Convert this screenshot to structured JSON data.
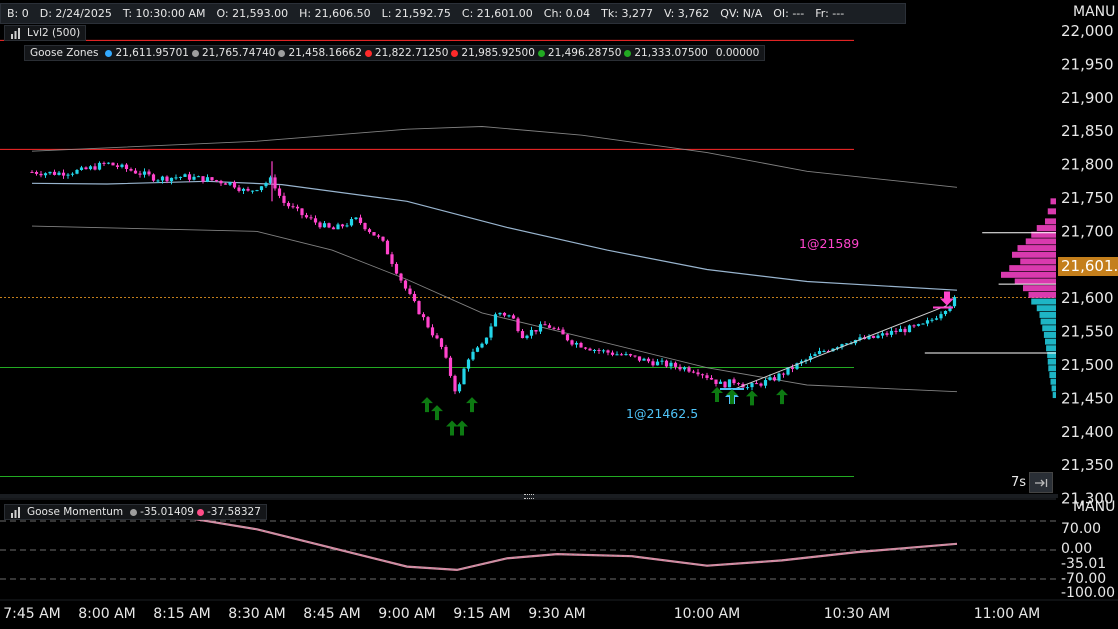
{
  "header": {
    "items": [
      "B: 0",
      "D: 2/24/2025",
      "T: 10:30:00 AM",
      "O: 21,593.00",
      "H: 21,606.50",
      "L: 21,592.75",
      "C: 21,601.00",
      "Ch: 0.04",
      "Tk: 3,277",
      "V: 3,762",
      "QV: N/A",
      "OI: ---",
      "Fr: ---"
    ]
  },
  "price_panel": {
    "scale_label": "MANU",
    "current_price": "21,601.0",
    "current_price_value": 21601,
    "bar_timeframe": "7s",
    "lvl2_label": "Lvl2 (500)",
    "zones_label": "Goose Zones",
    "zones": [
      {
        "value": "21,611.95701",
        "color": "#33aaff"
      },
      {
        "value": "21,765.74740",
        "color": "#9e9e9e"
      },
      {
        "value": "21,458.16662",
        "color": "#9e9e9e"
      },
      {
        "value": "21,822.71250",
        "color": "#ff2a2a"
      },
      {
        "value": "21,985.92500",
        "color": "#ff2a2a"
      },
      {
        "value": "21,496.28750",
        "color": "#22aa22"
      },
      {
        "value": "21,333.07500",
        "color": "#22aa22"
      },
      {
        "value": "0.00000",
        "color": null
      }
    ],
    "sell_annotation": "1@21589",
    "buy_annotation": "1@21462.5"
  },
  "momentum_panel": {
    "label": "Goose Momentum",
    "values": [
      {
        "value": "-35.01409",
        "color": "#9e9e9e"
      },
      {
        "value": "-37.58327",
        "color": "#ff4d88"
      }
    ],
    "scale_label": "MANU",
    "levels": [
      "70.00",
      "0.00",
      "-35.01",
      "-70.00",
      "-100.00"
    ]
  },
  "colors": {
    "up_candle": "#23d5e8",
    "down_candle": "#ff44cc",
    "accent": "#ff44cc",
    "buy": "#4fc3f7",
    "signal_arrow": "#0d7a12"
  },
  "chart_data": {
    "type": "candlestick",
    "x_ticks": [
      "7:45 AM",
      "8:00 AM",
      "8:15 AM",
      "8:30 AM",
      "8:45 AM",
      "9:00 AM",
      "9:15 AM",
      "9:30 AM",
      "10:00 AM",
      "10:30 AM",
      "11:00 AM"
    ],
    "y_ticks": [
      22000,
      21950,
      21900,
      21850,
      21800,
      21750,
      21700,
      21650,
      21600,
      21550,
      21500,
      21450,
      21400,
      21350,
      21300
    ],
    "ylim": [
      21300,
      22015
    ],
    "close_path": [
      [
        "7:45",
        21789
      ],
      [
        "7:50",
        21787
      ],
      [
        "7:55",
        21791
      ],
      [
        "8:00",
        21802
      ],
      [
        "8:05",
        21791
      ],
      [
        "8:10",
        21779
      ],
      [
        "8:15",
        21782
      ],
      [
        "8:20",
        21778
      ],
      [
        "8:25",
        21772
      ],
      [
        "8:28",
        21758
      ],
      [
        "8:33",
        21778
      ],
      [
        "8:35",
        21745
      ],
      [
        "8:40",
        21720
      ],
      [
        "8:45",
        21702
      ],
      [
        "8:50",
        21718
      ],
      [
        "8:55",
        21685
      ],
      [
        "9:00",
        21610
      ],
      [
        "9:02",
        21585
      ],
      [
        "9:07",
        21525
      ],
      [
        "9:10",
        21455
      ],
      [
        "9:12",
        21510
      ],
      [
        "9:15",
        21528
      ],
      [
        "9:18",
        21580
      ],
      [
        "9:21",
        21572
      ],
      [
        "9:23",
        21545
      ],
      [
        "9:28",
        21560
      ],
      [
        "9:33",
        21535
      ],
      [
        "9:38",
        21522
      ],
      [
        "9:43",
        21515
      ],
      [
        "9:48",
        21506
      ],
      [
        "9:53",
        21499
      ],
      [
        "9:58",
        21492
      ],
      [
        "10:03",
        21470
      ],
      [
        "10:06",
        21477
      ],
      [
        "10:08",
        21466
      ],
      [
        "10:13",
        21478
      ],
      [
        "10:18",
        21500
      ],
      [
        "10:23",
        21520
      ],
      [
        "10:28",
        21536
      ],
      [
        "10:33",
        21540
      ],
      [
        "10:38",
        21551
      ],
      [
        "10:43",
        21558
      ],
      [
        "10:45",
        21568
      ],
      [
        "10:50",
        21601
      ]
    ],
    "horizontal_lines": [
      {
        "name": "zone-red-upper",
        "value": 21985.925,
        "color": "#ff2a2a"
      },
      {
        "name": "zone-red-lower",
        "value": 21822.7125,
        "color": "#ff2a2a"
      },
      {
        "name": "zone-green-upper",
        "value": 21496.2875,
        "color": "#22aa22"
      },
      {
        "name": "zone-green-lower",
        "value": 21333.075,
        "color": "#22aa22"
      }
    ],
    "bands": [
      {
        "name": "upper-band",
        "color": "#8f8f8f",
        "path": [
          [
            "7:45",
            21820
          ],
          [
            "8:30",
            21835
          ],
          [
            "9:00",
            21853
          ],
          [
            "9:15",
            21857
          ],
          [
            "9:35",
            21844
          ],
          [
            "10:00",
            21818
          ],
          [
            "10:20",
            21790
          ],
          [
            "10:50",
            21766
          ]
        ]
      },
      {
        "name": "middle-band",
        "color": "#a9c8e4",
        "path": [
          [
            "7:45",
            21772
          ],
          [
            "8:00",
            21771
          ],
          [
            "8:20",
            21775
          ],
          [
            "8:35",
            21770
          ],
          [
            "9:00",
            21745
          ],
          [
            "9:20",
            21706
          ],
          [
            "9:40",
            21672
          ],
          [
            "10:00",
            21643
          ],
          [
            "10:20",
            21625
          ],
          [
            "10:50",
            21612
          ]
        ]
      },
      {
        "name": "lower-band",
        "color": "#8f8f8f",
        "path": [
          [
            "7:45",
            21708
          ],
          [
            "8:30",
            21700
          ],
          [
            "8:45",
            21672
          ],
          [
            "9:00",
            21628
          ],
          [
            "9:15",
            21578
          ],
          [
            "9:35",
            21542
          ],
          [
            "10:00",
            21496
          ],
          [
            "10:20",
            21470
          ],
          [
            "10:50",
            21460
          ]
        ]
      }
    ],
    "volume_profile": [
      {
        "price": 21745,
        "volume": 0.1
      },
      {
        "price": 21730,
        "volume": 0.15
      },
      {
        "price": 21715,
        "volume": 0.2
      },
      {
        "price": 21705,
        "volume": 0.35
      },
      {
        "price": 21695,
        "volume": 0.45
      },
      {
        "price": 21685,
        "volume": 0.55
      },
      {
        "price": 21675,
        "volume": 0.7
      },
      {
        "price": 21665,
        "volume": 0.8
      },
      {
        "price": 21655,
        "volume": 0.65
      },
      {
        "price": 21645,
        "volume": 0.85
      },
      {
        "price": 21635,
        "volume": 1.0
      },
      {
        "price": 21625,
        "volume": 0.75
      },
      {
        "price": 21615,
        "volume": 0.6
      },
      {
        "price": 21605,
        "volume": 0.5
      },
      {
        "price": 21595,
        "volume": 0.45
      },
      {
        "price": 21585,
        "volume": 0.35
      },
      {
        "price": 21575,
        "volume": 0.3
      },
      {
        "price": 21565,
        "volume": 0.28
      },
      {
        "price": 21555,
        "volume": 0.25
      },
      {
        "price": 21545,
        "volume": 0.22
      },
      {
        "price": 21535,
        "volume": 0.2
      },
      {
        "price": 21525,
        "volume": 0.18
      },
      {
        "price": 21515,
        "volume": 0.16
      },
      {
        "price": 21505,
        "volume": 0.15
      },
      {
        "price": 21495,
        "volume": 0.14
      },
      {
        "price": 21485,
        "volume": 0.12
      },
      {
        "price": 21475,
        "volume": 0.1
      },
      {
        "price": 21465,
        "volume": 0.08
      },
      {
        "price": 21455,
        "volume": 0.06
      }
    ],
    "profile_levels": [
      {
        "price": 21698,
        "extent": 0.9
      },
      {
        "price": 21621,
        "extent": 0.7
      },
      {
        "price": 21518,
        "extent": 1.6
      }
    ],
    "trades": [
      {
        "side": "sell",
        "time": "10:48",
        "price": 21589,
        "label": "1@21589"
      },
      {
        "side": "buy",
        "time": "10:05",
        "price": 21462.5,
        "label": "1@21462.5"
      }
    ],
    "trade_line": {
      "from": [
        "10:05",
        21462.5
      ],
      "to": [
        "10:48",
        21589
      ]
    },
    "signals": [
      {
        "time": "9:04",
        "price": 21440
      },
      {
        "time": "9:06",
        "price": 21428
      },
      {
        "time": "9:09",
        "price": 21405
      },
      {
        "time": "9:11",
        "price": 21405
      },
      {
        "time": "9:13",
        "price": 21440
      },
      {
        "time": "10:02",
        "price": 21455
      },
      {
        "time": "10:05",
        "price": 21452
      },
      {
        "time": "10:09",
        "price": 21450
      },
      {
        "time": "10:15",
        "price": 21452
      }
    ],
    "momentum": {
      "levels": [
        70,
        0,
        -70
      ],
      "path": [
        [
          "7:45",
          100
        ],
        [
          "7:55",
          104
        ],
        [
          "8:05",
          100
        ],
        [
          "8:15",
          80
        ],
        [
          "8:30",
          50
        ],
        [
          "8:45",
          5
        ],
        [
          "9:00",
          -40
        ],
        [
          "9:10",
          -48
        ],
        [
          "9:20",
          -20
        ],
        [
          "9:30",
          -10
        ],
        [
          "9:45",
          -15
        ],
        [
          "10:00",
          -38
        ],
        [
          "10:15",
          -25
        ],
        [
          "10:30",
          -5
        ],
        [
          "10:50",
          15
        ]
      ]
    }
  }
}
